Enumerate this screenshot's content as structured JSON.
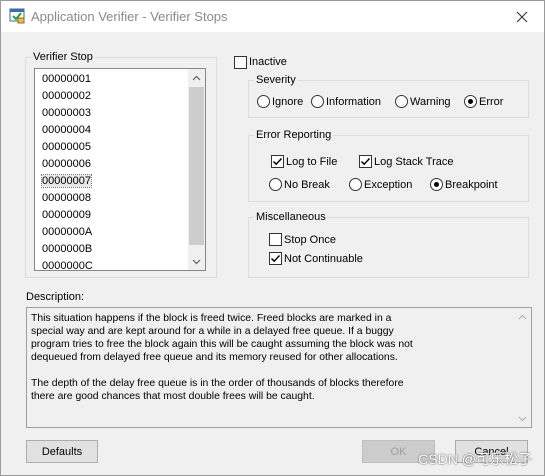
{
  "window": {
    "title": "Application Verifier - Verifier Stops"
  },
  "verifier_stop": {
    "label": "Verifier Stop",
    "items": [
      "00000001",
      "00000002",
      "00000003",
      "00000004",
      "00000005",
      "00000006",
      "00000007",
      "00000008",
      "00000009",
      "0000000A",
      "0000000B",
      "0000000C"
    ],
    "selected": "00000007"
  },
  "inactive": {
    "label": "Inactive",
    "checked": false
  },
  "severity": {
    "label": "Severity",
    "options": [
      "Ignore",
      "Information",
      "Warning",
      "Error"
    ],
    "selected": "Error"
  },
  "error_reporting": {
    "label": "Error Reporting",
    "log_to_file": {
      "label": "Log to File",
      "checked": true
    },
    "log_stack_trace": {
      "label": "Log Stack Trace",
      "checked": true
    },
    "options": [
      "No Break",
      "Exception",
      "Breakpoint"
    ],
    "selected": "Breakpoint"
  },
  "miscellaneous": {
    "label": "Miscellaneous",
    "stop_once": {
      "label": "Stop Once",
      "checked": false
    },
    "not_continuable": {
      "label": "Not Continuable",
      "checked": true
    }
  },
  "description": {
    "label": "Description:",
    "text": "This situation happens if the block is freed twice. Freed blocks are marked in a\nspecial way and are kept around for a while in a delayed free queue. If a buggy\nprogram tries to free the block again this will be caught assuming the block was not\ndequeued from delayed free queue and its memory reused for other allocations.\n\nThe depth of the delay free queue is in the order of thousands of blocks therefore\nthere are good chances that most double frees will be caught."
  },
  "buttons": {
    "defaults": "Defaults",
    "ok": "OK",
    "cancel": "Cancel"
  },
  "watermark": "CSDN @可乐松子",
  "icons": {
    "app": "application-verifier-icon",
    "close": "close-icon",
    "scroll_up": "chevron-up-icon",
    "scroll_down": "chevron-down-icon",
    "check": "checkmark-icon"
  },
  "colors": {
    "background": "#f0f0f0",
    "title_text": "#8a8a8a",
    "group_border": "#dcdcdc",
    "disabled_text": "#a0a0a0"
  }
}
